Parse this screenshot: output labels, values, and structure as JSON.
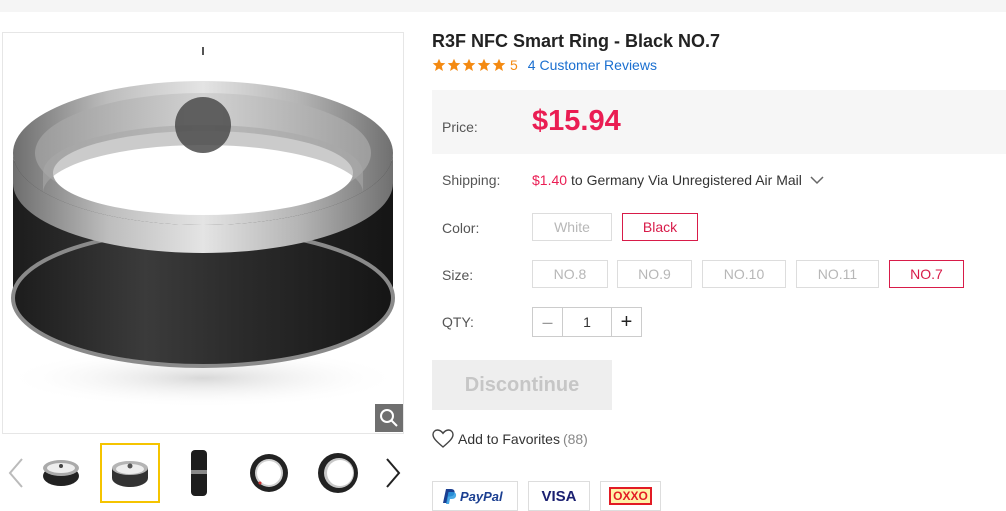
{
  "product": {
    "title": "R3F NFC Smart Ring - Black NO.7",
    "rating": "5",
    "stars": 5,
    "reviews_link": "4 Customer Reviews"
  },
  "price": {
    "label": "Price:",
    "value": "$15.94"
  },
  "shipping": {
    "label": "Shipping:",
    "cost": "$1.40",
    "description": "to Germany Via Unregistered Air Mail"
  },
  "color": {
    "label": "Color:",
    "options": [
      "White",
      "Black"
    ],
    "selected": "Black"
  },
  "size": {
    "label": "Size:",
    "options": [
      "NO.8",
      "NO.9",
      "NO.10",
      "NO.11",
      "NO.7"
    ],
    "selected": "NO.7"
  },
  "qty": {
    "label": "QTY:",
    "minus": "–",
    "value": "1",
    "plus": "+"
  },
  "actions": {
    "discontinue": "Discontinue",
    "favorites": "Add to Favorites",
    "favorites_count": "(88)"
  },
  "payments": [
    "PayPal",
    "VISA",
    "OXXO"
  ],
  "colors": {
    "accent": "#ea1d53",
    "star": "#f48a12",
    "link": "#1a6fd0",
    "thumb_selected": "#f5c400"
  },
  "icons": [
    "zoom-icon",
    "chevron-left-icon",
    "chevron-right-icon",
    "star-icon",
    "chevron-down-icon",
    "heart-icon"
  ]
}
